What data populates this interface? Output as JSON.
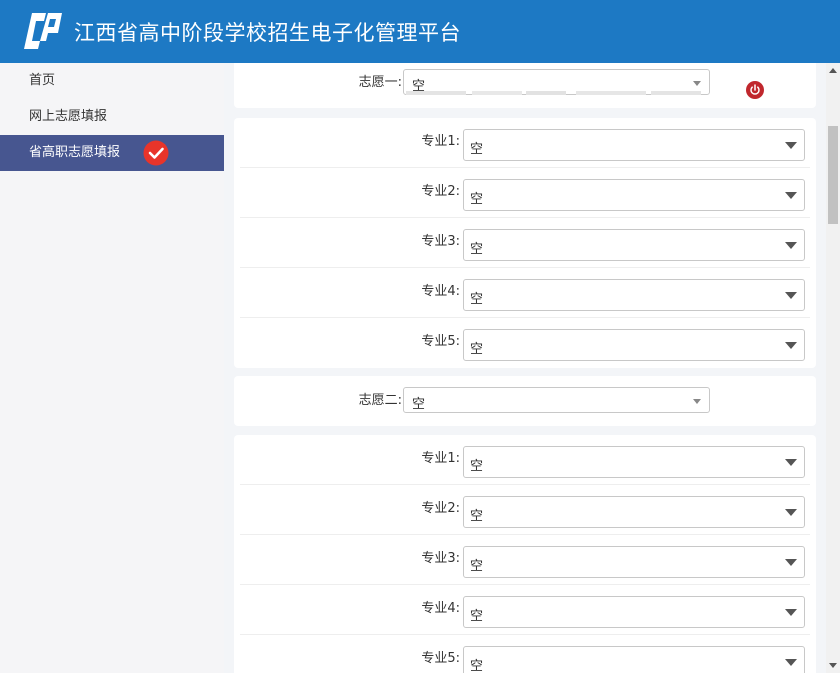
{
  "header": {
    "title": "江西省高中阶段学校招生电子化管理平台",
    "color": "#1d79c4",
    "logo_icon": "cp-logo-icon"
  },
  "sidebar": {
    "items": [
      {
        "label": "首页"
      },
      {
        "label": "网上志愿填报"
      },
      {
        "label": "省高职志愿填报"
      }
    ],
    "active_color": "#475690",
    "check_color": "#e8342a"
  },
  "volunteers": [
    {
      "label": "志愿一:",
      "value": "空",
      "majors": [
        {
          "label": "专业1:",
          "value": "空"
        },
        {
          "label": "专业2:",
          "value": "空"
        },
        {
          "label": "专业3:",
          "value": "空"
        },
        {
          "label": "专业4:",
          "value": "空"
        },
        {
          "label": "专业5:",
          "value": "空"
        }
      ]
    },
    {
      "label": "志愿二:",
      "value": "空",
      "majors": [
        {
          "label": "专业1:",
          "value": "空"
        },
        {
          "label": "专业2:",
          "value": "空"
        },
        {
          "label": "专业3:",
          "value": "空"
        },
        {
          "label": "专业4:",
          "value": "空"
        },
        {
          "label": "专业5:",
          "value": "空"
        }
      ]
    }
  ]
}
